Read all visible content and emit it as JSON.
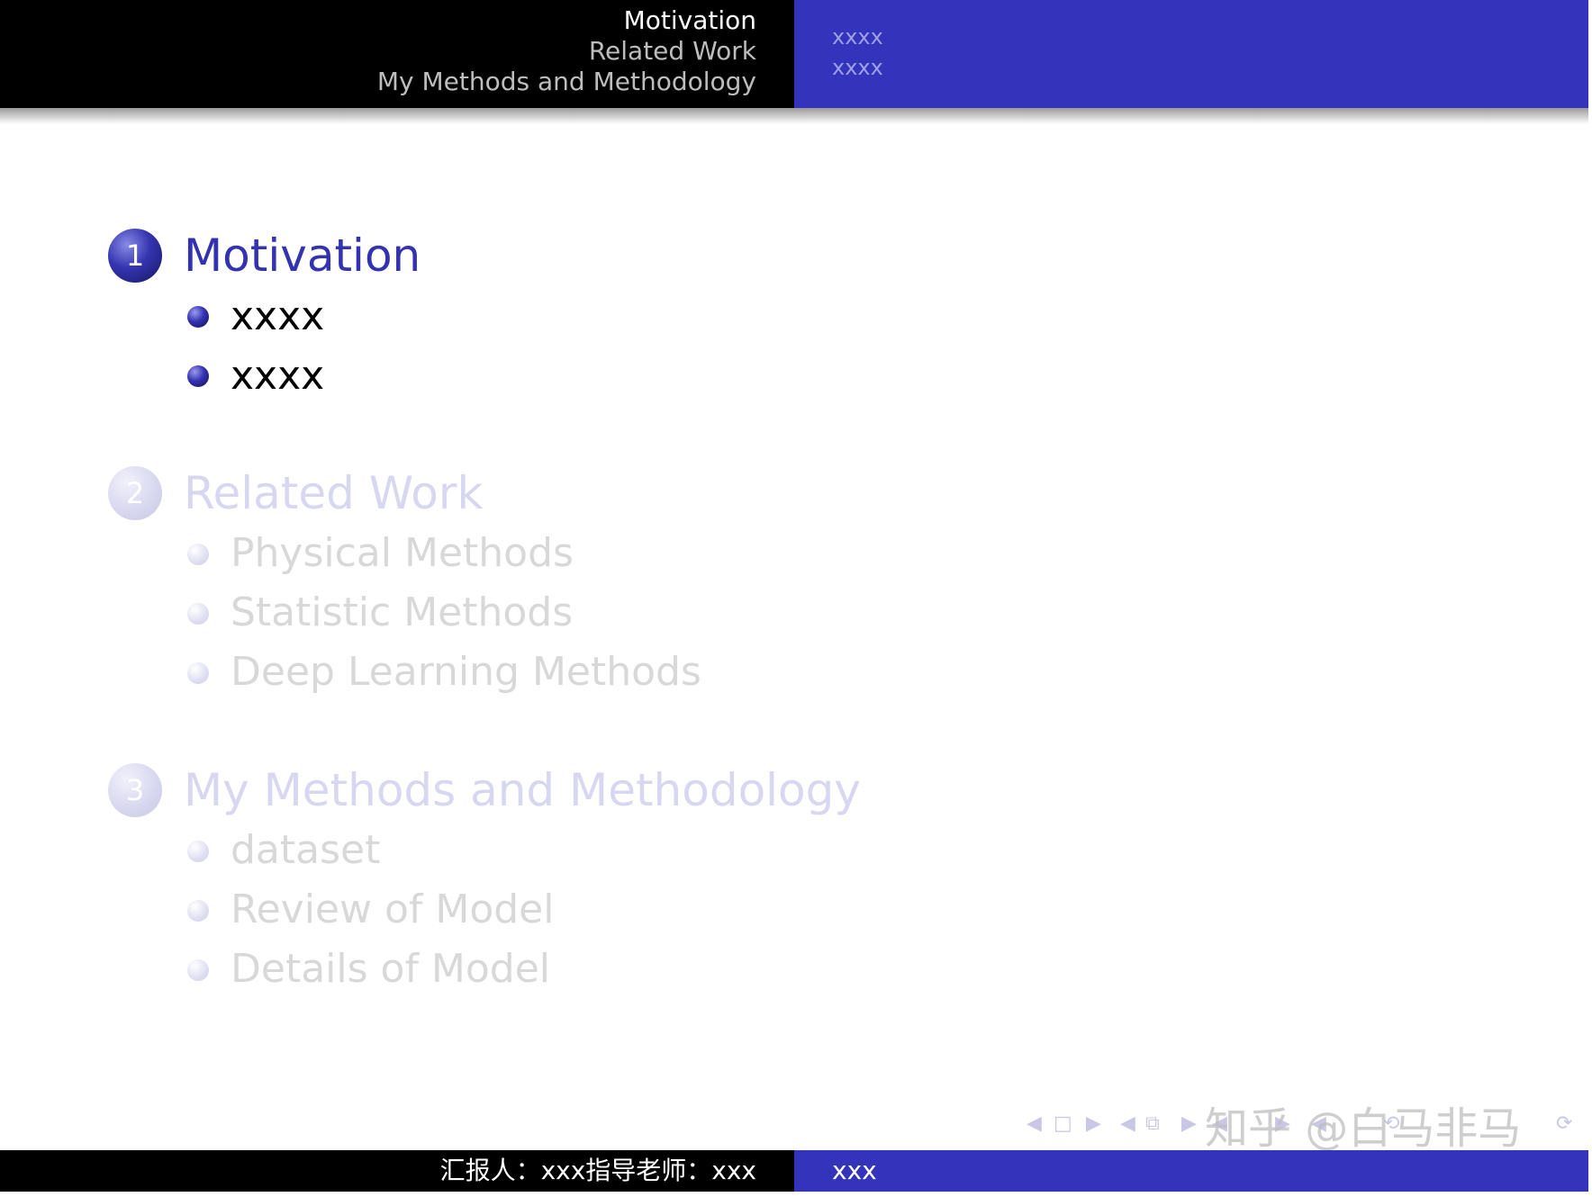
{
  "header": {
    "sections": [
      "Motivation",
      "Related Work",
      "My Methods and Methodology"
    ],
    "active_section_index": 0,
    "subsections": [
      "xxxx",
      "xxxx"
    ]
  },
  "toc": [
    {
      "number": "1",
      "title": "Motivation",
      "items": [
        "xxxx",
        "xxxx"
      ],
      "state": "active"
    },
    {
      "number": "2",
      "title": "Related Work",
      "items": [
        "Physical Methods",
        "Statistic Methods",
        "Deep Learning Methods"
      ],
      "state": "inactive"
    },
    {
      "number": "3",
      "title": "My Methods and Methodology",
      "items": [
        "dataset",
        "Review of Model",
        "Details of Model"
      ],
      "state": "inactive"
    }
  ],
  "footer": {
    "left": "汇报人：xxx指导老师：xxx",
    "right": "xxx"
  },
  "watermark": "知乎 @白马非马",
  "colors": {
    "accent": "#3333bb",
    "header_bg": "#000000",
    "inactive": "#d7d7f2"
  }
}
